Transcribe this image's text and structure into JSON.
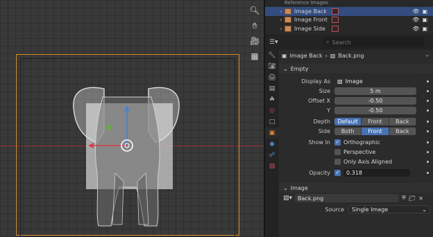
{
  "outliner": {
    "header": "Reference Images",
    "items": [
      {
        "label": "Image Back",
        "selected": true
      },
      {
        "label": "Image Front",
        "selected": false
      },
      {
        "label": "Image Side",
        "selected": false
      }
    ]
  },
  "props": {
    "search_placeholder": "Search",
    "breadcrumb": {
      "object": "Image Back",
      "data": "Back.png"
    },
    "empty_panel": {
      "title": "Empty",
      "display_as_label": "Display As",
      "display_as_value": "Image",
      "size_label": "Size",
      "size_value": "5 m",
      "offset_x_label": "Offset X",
      "offset_x_value": "-0.50",
      "offset_y_label": "Y",
      "offset_y_value": "-0.50",
      "depth_label": "Depth",
      "depth_options": [
        "Default",
        "Front",
        "Back"
      ],
      "depth_selected": "Default",
      "side_label": "Side",
      "side_options": [
        "Both",
        "Front",
        "Back"
      ],
      "side_selected": "Front",
      "show_in_label": "Show In",
      "orthographic": "Orthographic",
      "perspective": "Perspective",
      "only_axis_aligned": "Only Axis Aligned",
      "opacity_label": "Opacity",
      "opacity_value": "0.318"
    },
    "image_panel": {
      "title": "Image",
      "image_name": "Back.png",
      "source_label": "Source",
      "source_value": "Single Image"
    }
  },
  "colors": {
    "selection": "#334d80",
    "accent": "#4772b3",
    "camera_frame": "#d8902c"
  }
}
